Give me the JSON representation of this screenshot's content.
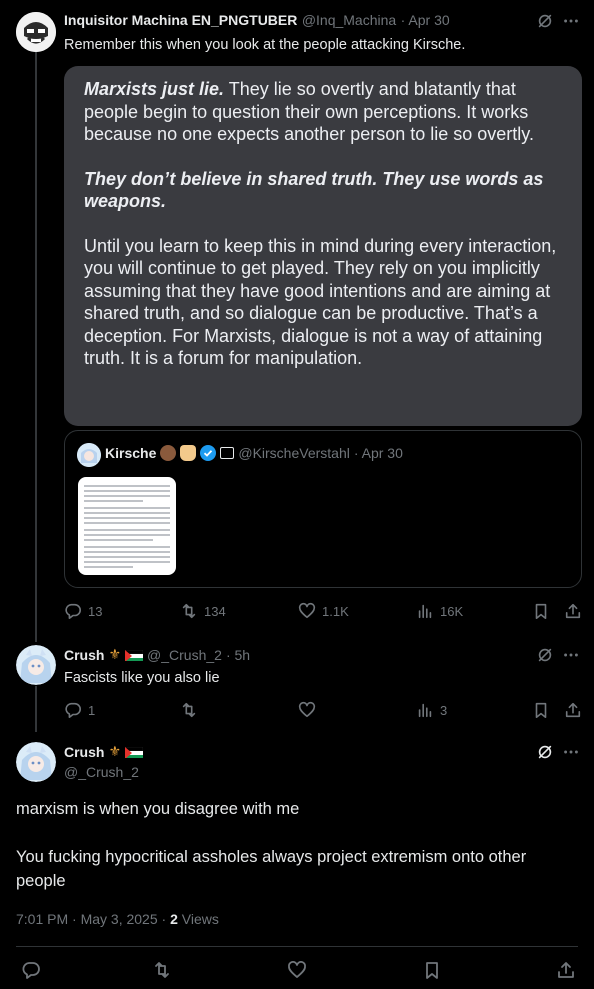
{
  "tweet1": {
    "author_name": "Inquisitor Machina EN_PNGTUBER",
    "author_handle": "@Inq_Machina",
    "date": "· Apr 30",
    "text": "Remember this when you look at the people attacking Kirsche.",
    "image_text": {
      "p1_bold": "Marxists just lie.",
      "p1_rest": " They lie so overtly and blatantly that people begin to question their own perceptions. It works because no one expects another person to lie so overtly.",
      "p2": "They don’t believe in shared truth. They use words as weapons.",
      "p3": "Until you learn to keep this in mind during every interaction, you will continue to get played. They rely on you implicitly assuming that they have good intentions and are aiming at shared truth, and so dialogue can be productive. That’s a deception. For Marxists, dialogue is not a way of attaining truth. It is a forum for manipulation."
    },
    "quoted": {
      "author_name": "Kirsche",
      "author_handle": "@KirscheVerstahl",
      "date": "· Apr 30"
    },
    "stats": {
      "replies": "13",
      "reposts": "134",
      "likes": "1.1K",
      "views": "16K"
    }
  },
  "tweet2": {
    "author_name": "Crush",
    "author_handle": "@_Crush_2",
    "date": "· 5h",
    "text": "Fascists like you also lie",
    "stats": {
      "replies": "1",
      "views": "3"
    }
  },
  "main_tweet": {
    "author_name": "Crush",
    "author_handle": "@_Crush_2",
    "line1": "marxism is when you disagree with me",
    "line2": "You fucking hypocritical assholes always project extremism onto other people",
    "timestamp": "7:01 PM · May 3, 2025 · ",
    "views_count": "2",
    "views_label": " Views"
  },
  "colors": {
    "background": "#000000",
    "text": "#e7e9ea",
    "muted": "#71767b",
    "verified": "#1d9bf0"
  },
  "icons": [
    "reply-icon",
    "repost-icon",
    "like-icon",
    "views-icon",
    "bookmark-icon",
    "share-icon",
    "grok-icon",
    "more-icon",
    "verified-icon"
  ]
}
